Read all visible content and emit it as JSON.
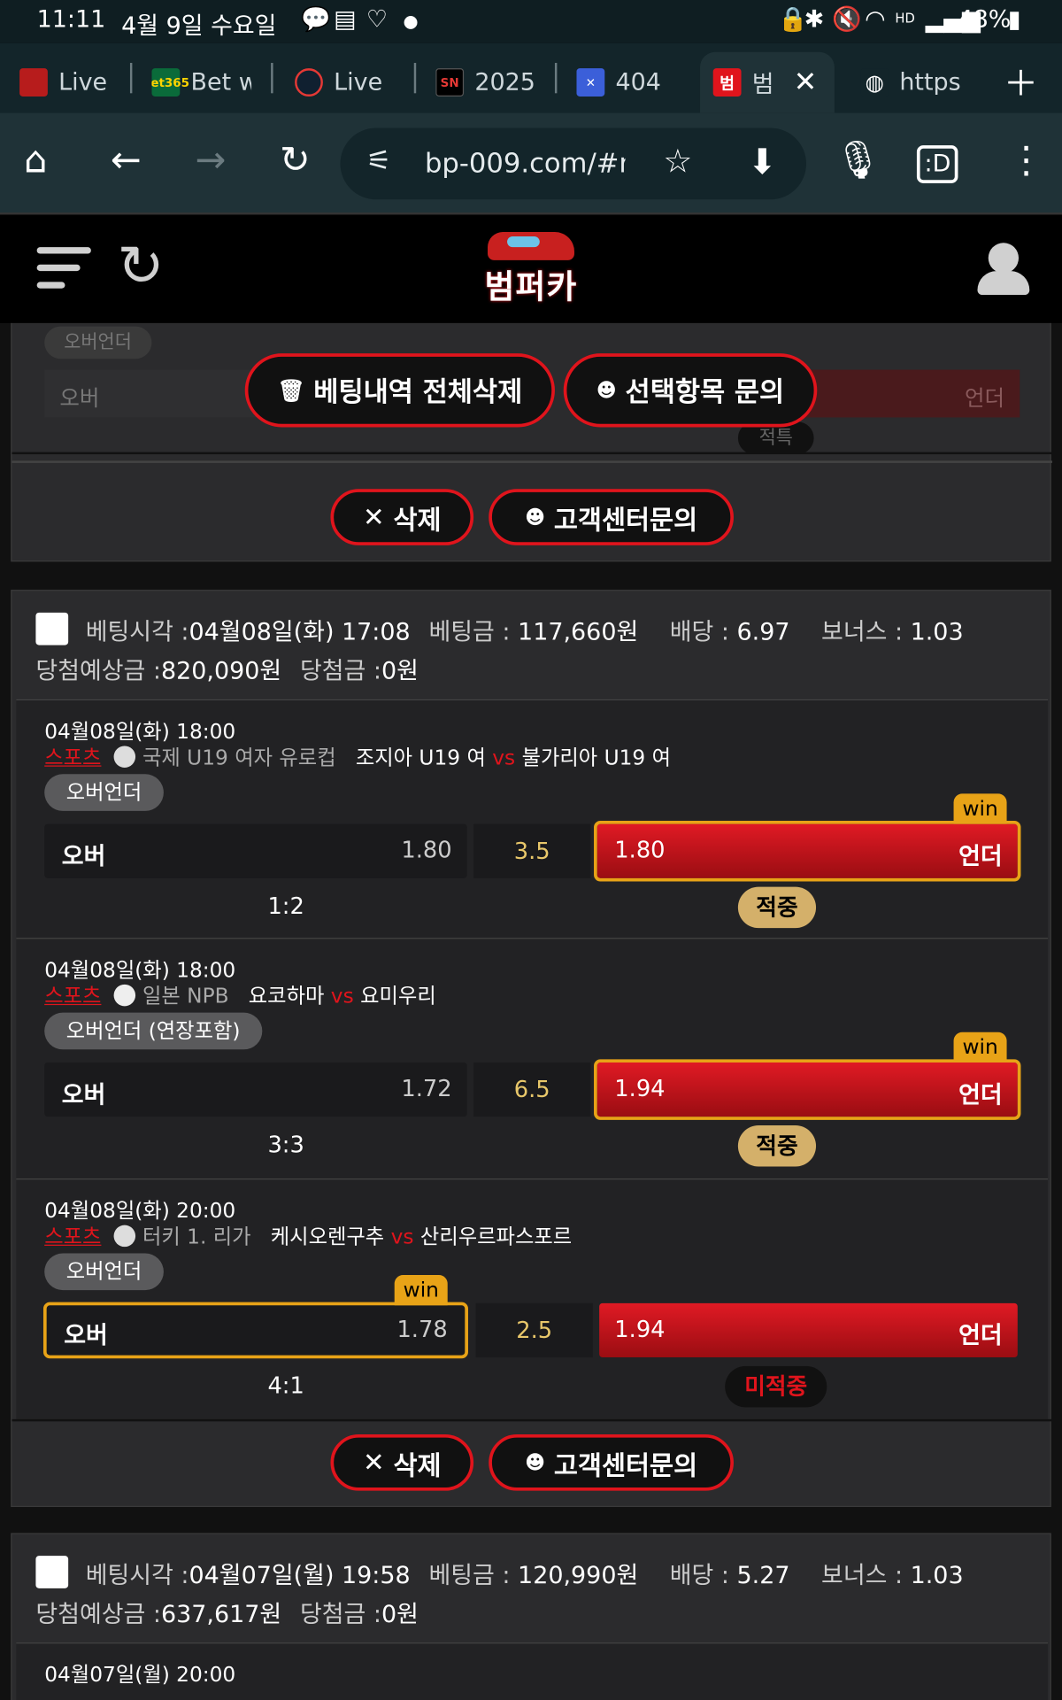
{
  "status": {
    "time": "11:11",
    "date": "4월 9일 수요일",
    "battery": "48%",
    "icons": [
      "talk-icon",
      "news-icon",
      "heart-icon",
      "dot-icon",
      "lock-icon",
      "bluetooth-icon",
      "mute-icon",
      "wifi-icon",
      "hd-voice-icon",
      "signal-icon",
      "battery-icon"
    ]
  },
  "tabs": [
    {
      "label": "Live",
      "fav": ""
    },
    {
      "label": "Bet w",
      "fav": "bet365"
    },
    {
      "label": "Live",
      "fav": ""
    },
    {
      "label": "2025",
      "fav": "SN"
    },
    {
      "label": "404",
      "fav": "✕"
    },
    {
      "label": "범",
      "fav": "범",
      "active": true
    },
    {
      "label": "https",
      "fav": ""
    }
  ],
  "browser": {
    "url": "bp-009.com/#r"
  },
  "site": {
    "logo_name": "범퍼카"
  },
  "top_buttons": {
    "delete_all": "베팅내역 전체삭제",
    "inquire_selected": "선택항목 문의"
  },
  "ghost": {
    "badge": "오버언더",
    "over": "오버",
    "under": "언더",
    "hit": "적특"
  },
  "labels": {
    "delete": "삭제",
    "cs": "고객센터문의",
    "bet_time": "베팅시각 :",
    "bet_amount": "베팅금 :",
    "odds": "배당 :",
    "bonus": "보너스 :",
    "expected": "당첨예상금 :",
    "won": "당첨금 :",
    "sports": "스포츠",
    "vs": "vs",
    "win": "win"
  },
  "bets": [
    {
      "time": "04월08일(화) 17:08",
      "amount": "117,660원",
      "odds": "6.97",
      "bonus": "1.03",
      "expected": "820,090원",
      "won": "0원",
      "matches": [
        {
          "date": "04월08일(화) 18:00",
          "league": "국제 U19 여자 유로컵",
          "home": "조지아 U19 여",
          "away": "불가리아 U19 여",
          "market": "오버언더",
          "over_label": "오버",
          "over_odd": "1.80",
          "line": "3.5",
          "under_odd": "1.80",
          "under_label": "언더",
          "score": "1:2",
          "result": "적중"
        },
        {
          "date": "04월08일(화) 18:00",
          "league": "일본 NPB",
          "home": "요코하마",
          "away": "요미우리",
          "market": "오버언더 (연장포함)",
          "over_label": "오버",
          "over_odd": "1.72",
          "line": "6.5",
          "under_odd": "1.94",
          "under_label": "언더",
          "score": "3:3",
          "result": "적중"
        },
        {
          "date": "04월08일(화) 20:00",
          "league": "터키 1. 리가",
          "home": "케시오렌구추",
          "away": "산리우르파스포르",
          "market": "오버언더",
          "over_label": "오버",
          "over_odd": "1.78",
          "line": "2.5",
          "under_odd": "1.94",
          "under_label": "언더",
          "score": "4:1",
          "result": "미적중"
        }
      ]
    },
    {
      "time": "04월07일(월) 19:58",
      "amount": "120,990원",
      "odds": "5.27",
      "bonus": "1.03",
      "expected": "637,617원",
      "won": "0원",
      "matches": [
        {
          "date": "04월07일(월) 20:00"
        }
      ]
    }
  ]
}
